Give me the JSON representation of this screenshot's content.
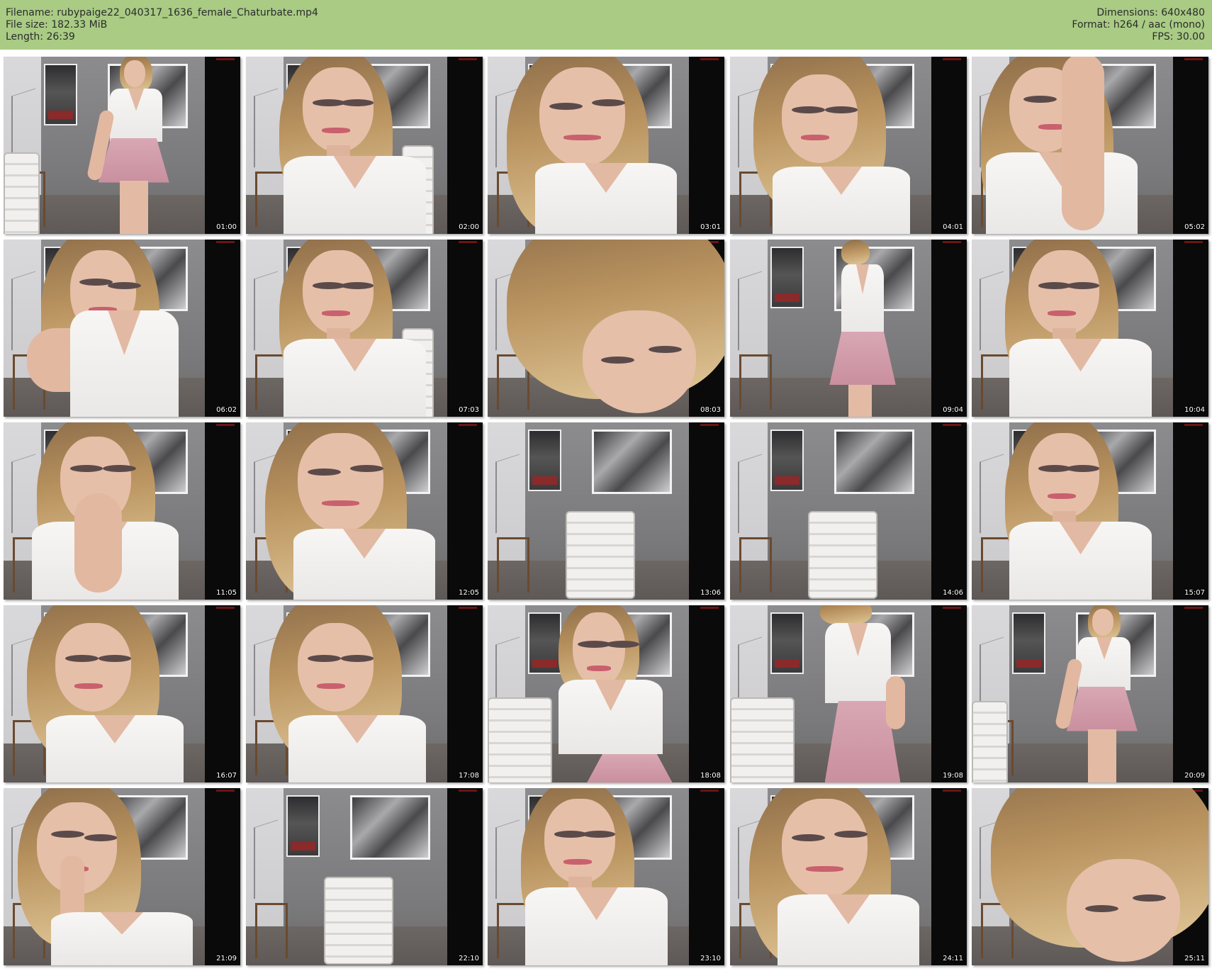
{
  "header": {
    "filename_line": "Filename: rubypaige22_040317_1636_female_Chaturbate.mp4",
    "filesize_line": "File size: 182.33 MiB",
    "length_line": "Length: 26:39",
    "dimensions_line": "Dimensions: 640x480",
    "format_line": "Format: h264 / aac (mono)",
    "fps_line": "FPS: 30.00"
  },
  "colors": {
    "header_background": "#a9cb84",
    "page_background": "#ffffff",
    "timestamp_text": "#ffffff"
  },
  "thumbnails": [
    {
      "timestamp": "01:00",
      "scene": "full-body-standing-skirt"
    },
    {
      "timestamp": "02:00",
      "scene": "closeup-seated"
    },
    {
      "timestamp": "03:01",
      "scene": "closeup-smile"
    },
    {
      "timestamp": "04:01",
      "scene": "closeup-looking-down"
    },
    {
      "timestamp": "05:02",
      "scene": "hand-over-face"
    },
    {
      "timestamp": "06:02",
      "scene": "closeup-hand-in-hair"
    },
    {
      "timestamp": "07:03",
      "scene": "closeup-seated"
    },
    {
      "timestamp": "08:03",
      "scene": "extreme-closeup-hair"
    },
    {
      "timestamp": "09:04",
      "scene": "standing-arm-raised"
    },
    {
      "timestamp": "10:04",
      "scene": "closeup-seated"
    },
    {
      "timestamp": "11:05",
      "scene": "hands-over-mouth"
    },
    {
      "timestamp": "12:05",
      "scene": "closeup-smile"
    },
    {
      "timestamp": "13:06",
      "scene": "empty-chair"
    },
    {
      "timestamp": "14:06",
      "scene": "empty-chair"
    },
    {
      "timestamp": "15:07",
      "scene": "closeup-seated"
    },
    {
      "timestamp": "16:07",
      "scene": "closeup-looking-down"
    },
    {
      "timestamp": "17:08",
      "scene": "closeup-looking-down"
    },
    {
      "timestamp": "18:08",
      "scene": "leaning-forward"
    },
    {
      "timestamp": "19:08",
      "scene": "standing-holding-skirt"
    },
    {
      "timestamp": "20:09",
      "scene": "full-body-standing-skirt"
    },
    {
      "timestamp": "21:09",
      "scene": "finger-on-lips"
    },
    {
      "timestamp": "22:10",
      "scene": "empty-chair"
    },
    {
      "timestamp": "23:10",
      "scene": "closeup-seated"
    },
    {
      "timestamp": "24:11",
      "scene": "closeup-smile"
    },
    {
      "timestamp": "25:11",
      "scene": "extreme-closeup-hair"
    }
  ]
}
